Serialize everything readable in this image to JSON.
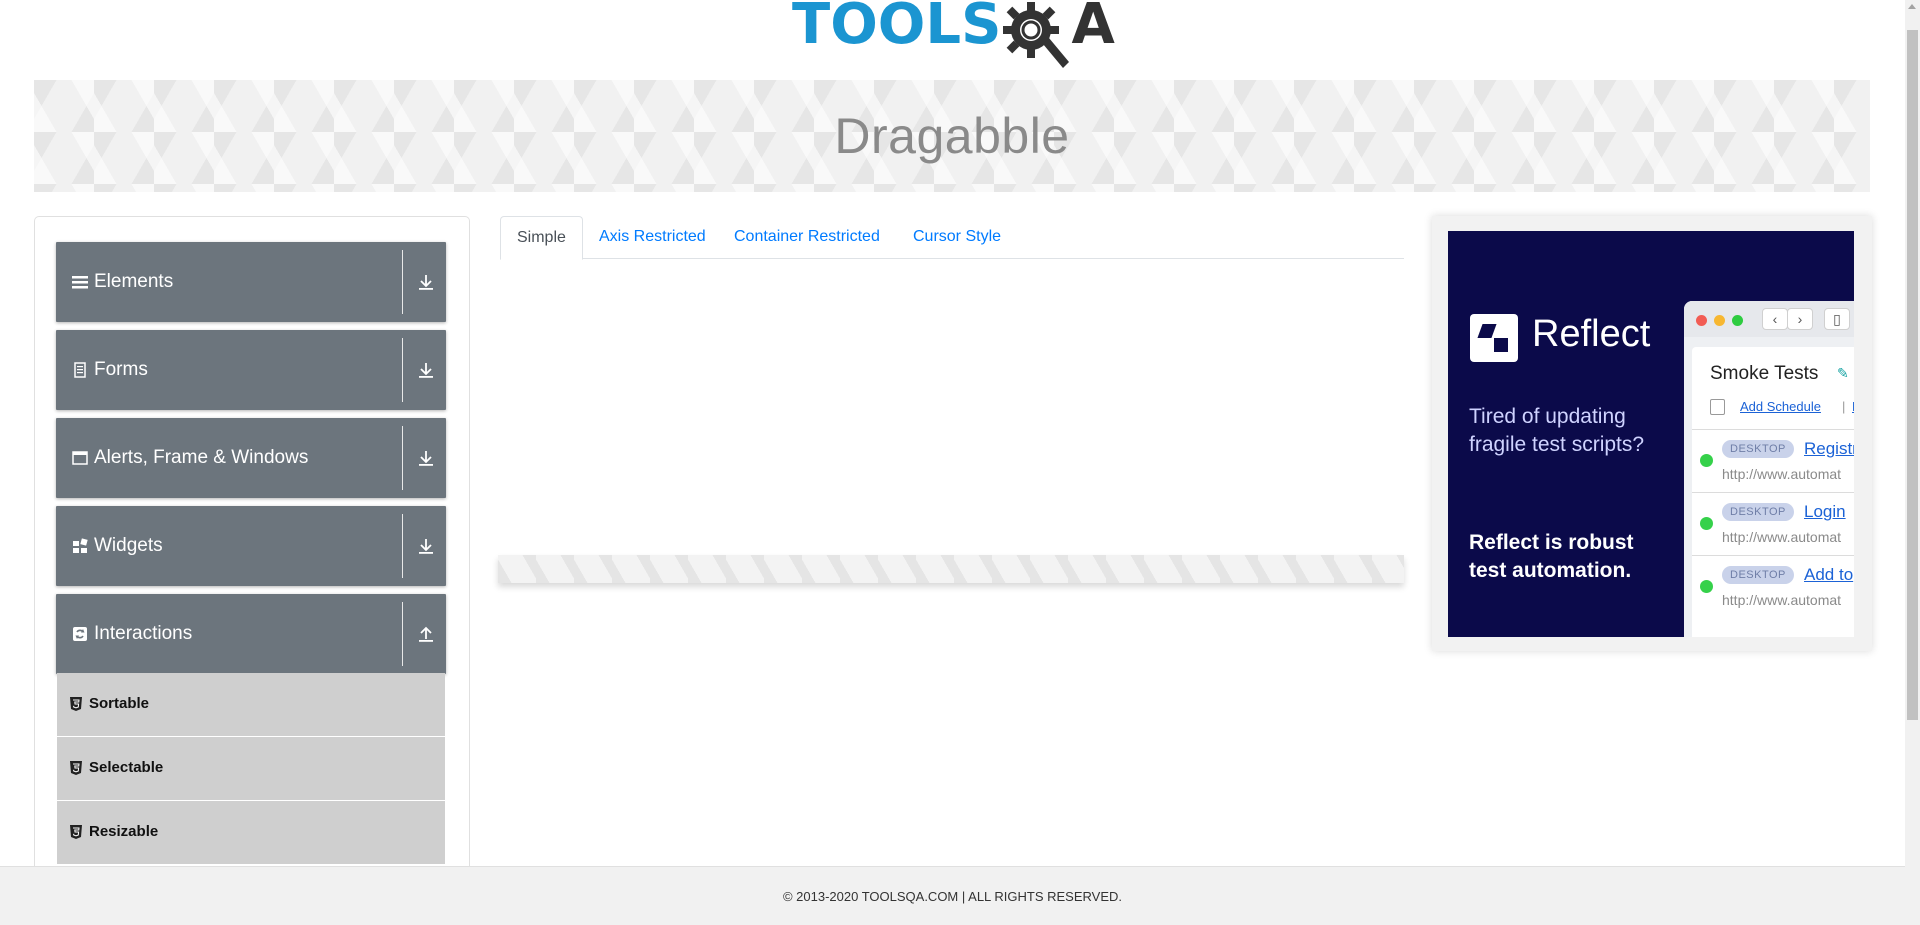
{
  "header": {
    "logo_tools": "TOOLS",
    "logo_qa": "A",
    "logo_aria": "TOOLSQA"
  },
  "banner": {
    "title": "Dragabble"
  },
  "sidebar": {
    "groups": [
      {
        "label": "Elements",
        "icon": "list-icon",
        "expanded": false
      },
      {
        "label": "Forms",
        "icon": "document-icon",
        "expanded": false
      },
      {
        "label": "Alerts, Frame & Windows",
        "icon": "window-icon",
        "expanded": false
      },
      {
        "label": "Widgets",
        "icon": "widgets-icon",
        "expanded": false
      },
      {
        "label": "Interactions",
        "icon": "interactions-icon",
        "expanded": true
      }
    ],
    "items": [
      {
        "label": "Sortable"
      },
      {
        "label": "Selectable"
      },
      {
        "label": "Resizable"
      }
    ]
  },
  "tabs": [
    {
      "label": "Simple",
      "active": true
    },
    {
      "label": "Axis Restricted",
      "active": false
    },
    {
      "label": "Container Restricted",
      "active": false
    },
    {
      "label": "Cursor Style",
      "active": false
    }
  ],
  "ad": {
    "brand": "Reflect",
    "copy1": "Tired of updating fragile test scripts?",
    "copy2": "Reflect is robust test automation.",
    "window_title": "Smoke Tests",
    "schedule_link": "Add Schedule",
    "separator": "|",
    "run_link": "Ru",
    "rows": [
      {
        "badge": "DESKTOP",
        "link": "Registr",
        "url": "http://www.automat"
      },
      {
        "badge": "DESKTOP",
        "link": "Login",
        "url": "http://www.automat"
      },
      {
        "badge": "DESKTOP",
        "link": "Add to",
        "url": "http://www.automat"
      }
    ],
    "colors": {
      "background": "#0b0a4a",
      "status_ok": "#35d14a"
    }
  },
  "footer": {
    "text": "© 2013-2020 TOOLSQA.COM | ALL RIGHTS RESERVED."
  },
  "colors": {
    "accent": "#007bff",
    "group_bg": "#6c757d",
    "item_bg": "#cfcfcf",
    "logo_blue": "#1b95d1"
  }
}
